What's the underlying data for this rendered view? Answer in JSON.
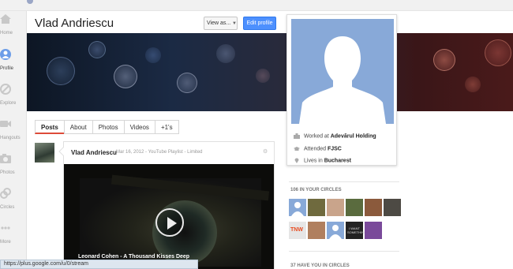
{
  "nav": [
    {
      "key": "home",
      "label": "Home",
      "active": false
    },
    {
      "key": "profile",
      "label": "Profile",
      "active": true
    },
    {
      "key": "explore",
      "label": "Explore",
      "active": false
    },
    {
      "key": "hangouts",
      "label": "Hangouts",
      "active": false
    },
    {
      "key": "photos",
      "label": "Photos",
      "active": false
    },
    {
      "key": "circles",
      "label": "Circles",
      "active": false
    },
    {
      "key": "more",
      "label": "More",
      "active": false
    }
  ],
  "header": {
    "name": "Vlad Andriescu",
    "view_as_label": "View as...",
    "edit_profile_label": "Edit profile"
  },
  "tabs": [
    "Posts",
    "About",
    "Photos",
    "Videos",
    "+1's"
  ],
  "post": {
    "author": "Vlad Andriescu",
    "meta": "Mar 16, 2012  -  YouTube Playlist  -  Limited",
    "video_title": "Leonard Cohen - A Thousand Kisses Deep"
  },
  "profile_card": {
    "items": [
      {
        "prefix": "Worked at ",
        "value": "Adevărul Holding",
        "icon": "work-icon"
      },
      {
        "prefix": "Attended ",
        "value": "FJSC",
        "icon": "education-icon"
      },
      {
        "prefix": "Lives in ",
        "value": "Bucharest",
        "icon": "location-icon"
      }
    ]
  },
  "circles": {
    "in_your_circles": "106 IN YOUR CIRCLES",
    "have_you": "37 HAVE YOU IN CIRCLES",
    "avatar_colors_row1": [
      "#88a9d8",
      "#6f6a3e",
      "#c9a48b",
      "#5a6b3e",
      "#8b5a3c",
      "#4d4a44"
    ],
    "avatar_colors_row2": [
      "#e6e6e6",
      "#b07f5e",
      "#88a9d8",
      "#232323",
      "#7a4a9a"
    ],
    "tnw_text": "TNW",
    "shareit_text": "I WANT SOMETHING"
  },
  "status_bar": {
    "url": "https://plus.google.com/u/0/stream"
  },
  "colors": {
    "accent_blue": "#4d90fe",
    "tab_active": "#dd4b39",
    "silhouette_bg": "#88a9d8"
  }
}
